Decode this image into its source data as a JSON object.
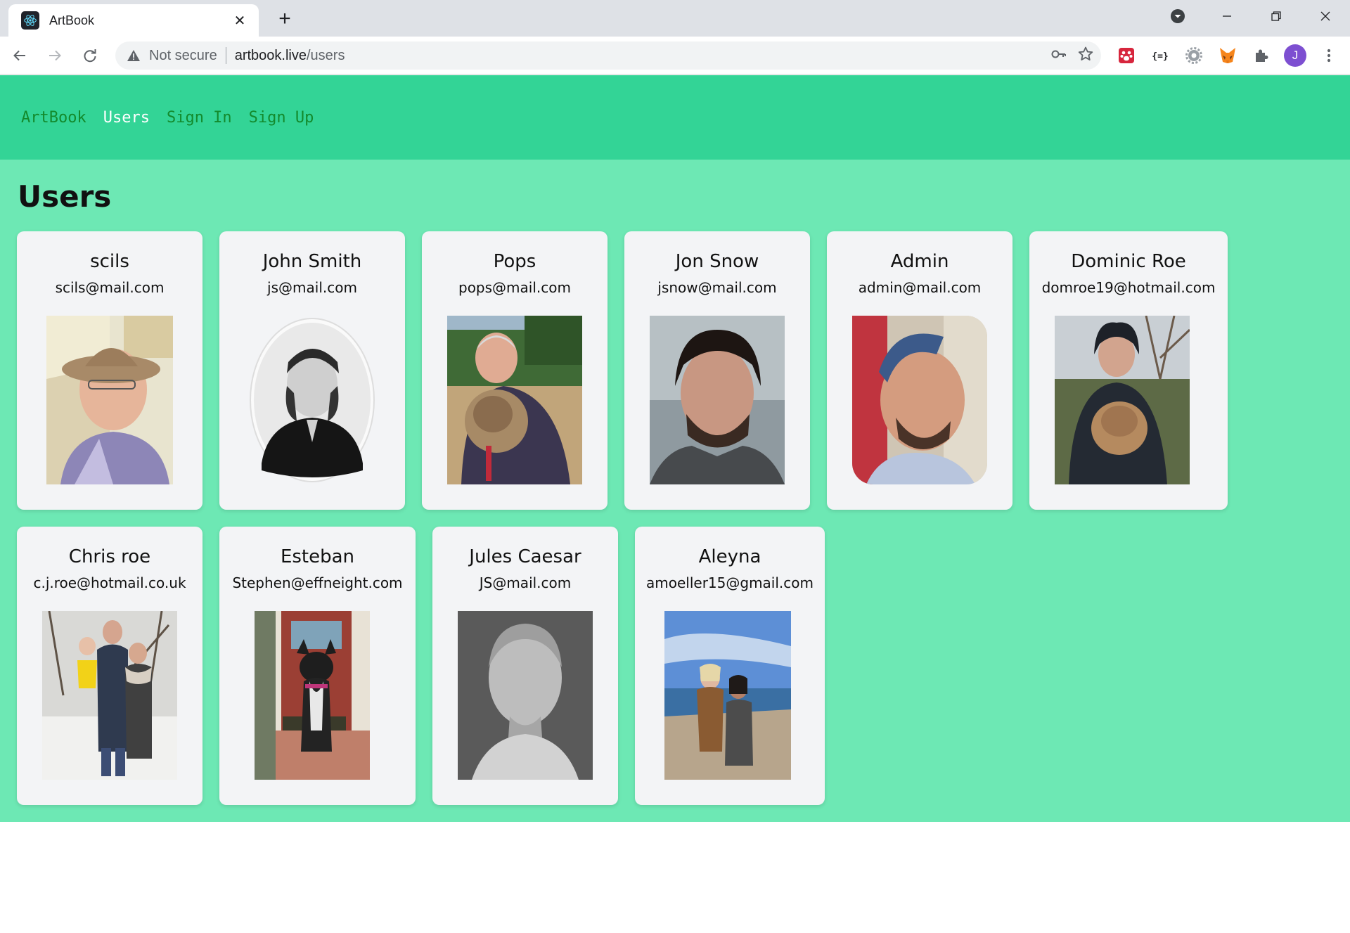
{
  "browser": {
    "tab_title": "ArtBook",
    "tab_close": "✕",
    "new_tab": "+",
    "not_secure": "Not secure",
    "url_host": "artbook.live",
    "url_path": "/users",
    "avatar_letter": "J"
  },
  "nav": {
    "brand": "ArtBook",
    "users": "Users",
    "sign_in": "Sign In",
    "sign_up": "Sign Up"
  },
  "page": {
    "title": "Users"
  },
  "users": [
    {
      "name": "scils",
      "email": "scils@mail.com"
    },
    {
      "name": "John Smith",
      "email": "js@mail.com"
    },
    {
      "name": "Pops",
      "email": "pops@mail.com"
    },
    {
      "name": "Jon Snow",
      "email": "jsnow@mail.com"
    },
    {
      "name": "Admin",
      "email": "admin@mail.com"
    },
    {
      "name": "Dominic Roe",
      "email": "domroe19@hotmail.com"
    },
    {
      "name": "Chris roe",
      "email": "c.j.roe@hotmail.co.uk"
    },
    {
      "name": "Esteban",
      "email": "Stephen@effneight.com"
    },
    {
      "name": "Jules Caesar",
      "email": "JS@mail.com"
    },
    {
      "name": "Aleyna",
      "email": "amoeller15@gmail.com"
    }
  ],
  "colors": {
    "page_bg": "#6de8b4",
    "navbar_bg": "#33d496",
    "nav_link": "#138a2c",
    "nav_active": "#ffffff",
    "card_bg": "#f3f4f6"
  }
}
